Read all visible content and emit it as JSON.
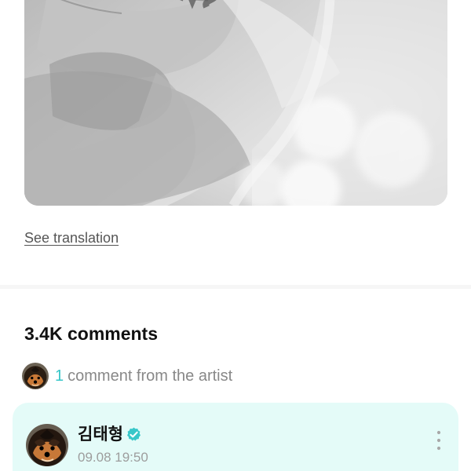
{
  "post": {
    "translation_link": "See translation"
  },
  "comments": {
    "count_label": "3.4K comments",
    "artist_summary": {
      "count": "1",
      "label": "comment from the artist"
    }
  },
  "artist_comment": {
    "author": "김태형",
    "timestamp": "09.08 19:50"
  },
  "icons": {
    "verified": "verified-check-icon",
    "more": "vertical-ellipsis-icon"
  },
  "colors": {
    "accent": "#36c6c8",
    "artist_card_background": "#e4fbf8",
    "secondary_text": "#888888",
    "timestamp_text": "#9d9d9d",
    "divider": "#f6f6f6"
  }
}
